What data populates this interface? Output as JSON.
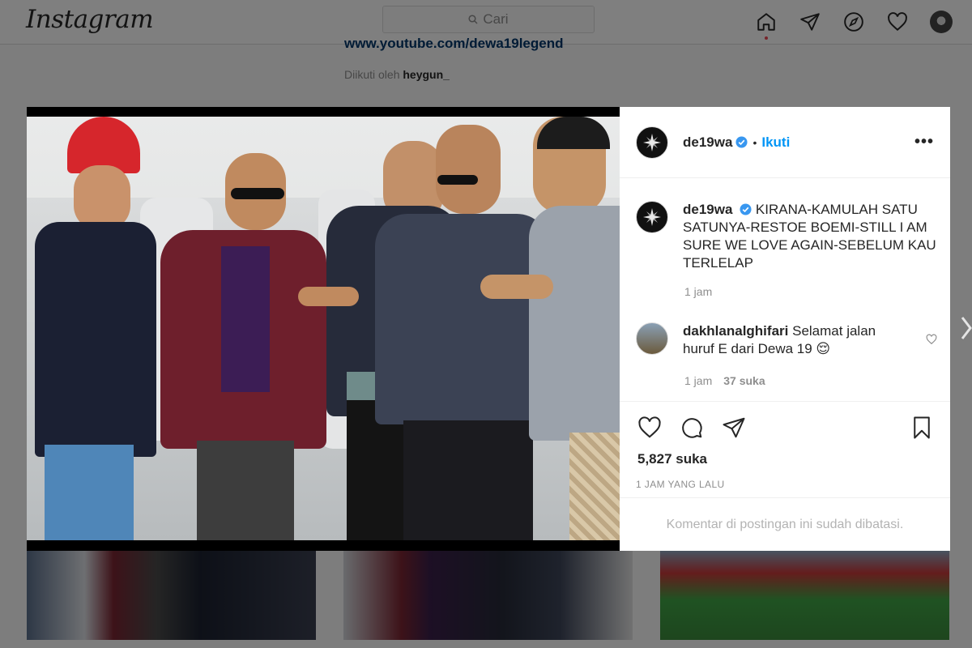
{
  "app": {
    "logo_text": "Instagram"
  },
  "search": {
    "placeholder": "Cari"
  },
  "nav": {
    "icons": [
      "home-icon",
      "direct-icon",
      "explore-icon",
      "activity-heart-icon",
      "profile-avatar"
    ]
  },
  "profile_bg": {
    "bio_url": "www.youtube.com/dewa19legend",
    "followed_prefix": "Diikuti oleh",
    "followed_user": "heygun_"
  },
  "post": {
    "username": "de19wa",
    "follow_label": "Ikuti",
    "more_label": "•••",
    "caption": "KIRANA-KAMULAH SATU SATUNYA-RESTOE BOEMI-STILL I AM SURE WE LOVE AGAIN-SEBELUM KAU TERLELAP",
    "caption_time": "1 jam",
    "comments": [
      {
        "username": "dakhlanalghifari",
        "text": "Selamat jalan huruf E dari Dewa 19 😌",
        "time": "1 jam",
        "likes": "37 suka"
      }
    ],
    "likes": "5,827 suka",
    "timestamp": "1 JAM YANG LALU",
    "comments_limited": "Komentar di postingan ini sudah dibatasi."
  },
  "colors": {
    "accent": "#0095f6",
    "verified": "#3897f0",
    "notif": "#ed4956"
  }
}
